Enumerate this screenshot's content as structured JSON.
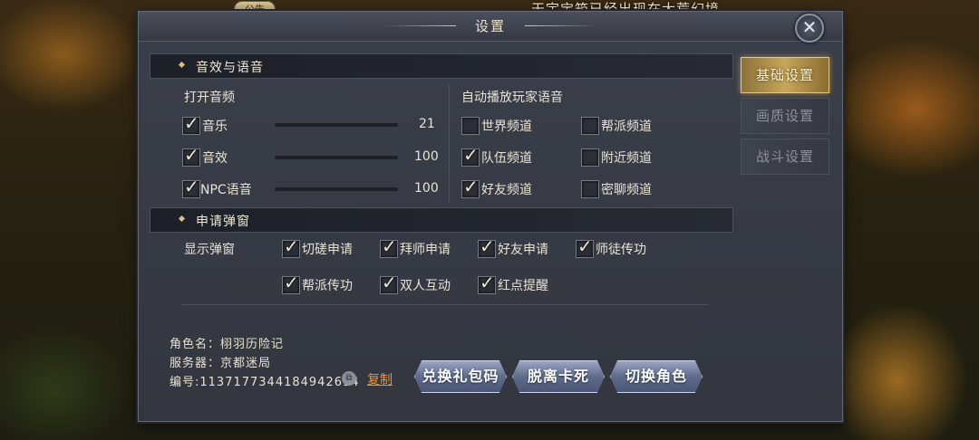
{
  "ticker": {
    "notice_tag": "公告",
    "text": "天宇宝箱已经出现在大荒幻境"
  },
  "window": {
    "title": "设置",
    "close_label": "✕"
  },
  "audio": {
    "section_title": "音效与语音",
    "open_audio_label": "打开音频",
    "items": [
      {
        "label": "音乐",
        "checked": true,
        "value": "21",
        "level": 0.21
      },
      {
        "label": "音效",
        "checked": true,
        "value": "100",
        "level": 1.0
      },
      {
        "label": "NPC语音",
        "checked": true,
        "value": "100",
        "level": 1.0
      }
    ],
    "autoplay_label": "自动播放玩家语音",
    "channels": [
      {
        "label": "世界频道",
        "checked": false
      },
      {
        "label": "帮派频道",
        "checked": false
      },
      {
        "label": "队伍频道",
        "checked": true
      },
      {
        "label": "附近频道",
        "checked": false
      },
      {
        "label": "好友频道",
        "checked": true
      },
      {
        "label": "密聊频道",
        "checked": false
      }
    ]
  },
  "popups": {
    "section_title": "申请弹窗",
    "display_label": "显示弹窗",
    "items": [
      {
        "label": "切磋申请",
        "checked": true
      },
      {
        "label": "拜师申请",
        "checked": true
      },
      {
        "label": "好友申请",
        "checked": true
      },
      {
        "label": "师徒传功",
        "checked": true
      },
      {
        "label": "帮派传功",
        "checked": true
      },
      {
        "label": "双人互动",
        "checked": true
      },
      {
        "label": "红点提醒",
        "checked": true
      }
    ]
  },
  "account": {
    "name_line": "角色名：栩羽历险记",
    "server_line": "服务器：京都迷局",
    "id_line": "编号:1137177344184942614",
    "copy_label": "复制"
  },
  "buttons": {
    "redeem": "兑换礼包码",
    "unstuck": "脱离卡死",
    "switch_role": "切换角色"
  },
  "sidebar": {
    "tabs": [
      {
        "label": "基础设置",
        "active": true
      },
      {
        "label": "画质设置",
        "active": false
      },
      {
        "label": "战斗设置",
        "active": false
      }
    ]
  },
  "colors": {
    "accent_gold": "#c7a65a",
    "copy_link": "#e5973a",
    "panel": "#33363f"
  }
}
